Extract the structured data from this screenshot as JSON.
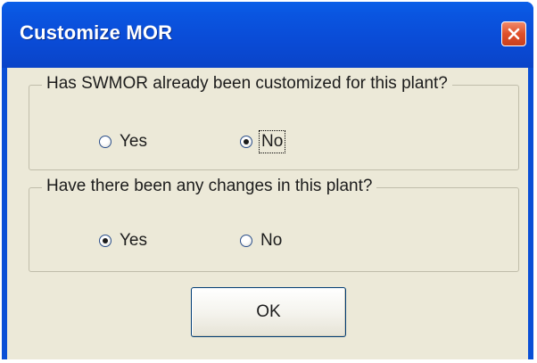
{
  "window": {
    "title": "Customize MOR",
    "close_icon": "close-icon",
    "accent_color": "#0a4fd6",
    "close_color": "#e0502a"
  },
  "group1": {
    "legend": "Has SWMOR already been customized for this plant?",
    "options": [
      {
        "label": "Yes",
        "selected": false
      },
      {
        "label": "No",
        "selected": true,
        "focused": true
      }
    ]
  },
  "group2": {
    "legend": "Have there been any changes in this plant?",
    "options": [
      {
        "label": "Yes",
        "selected": true
      },
      {
        "label": "No",
        "selected": false
      }
    ]
  },
  "ok_button": {
    "label": "OK"
  }
}
